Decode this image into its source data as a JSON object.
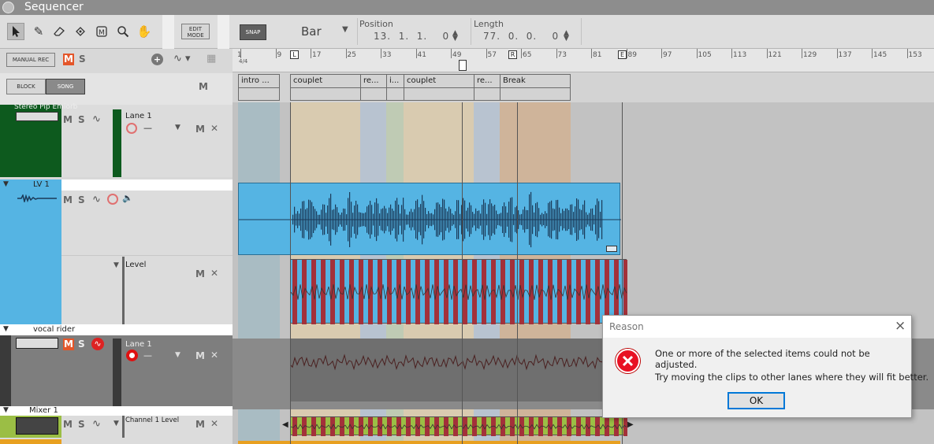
{
  "window": {
    "title": "Sequencer"
  },
  "toolbar": {
    "tools": [
      "select-arrow-icon",
      "pencil-icon",
      "eraser-icon",
      "razor-icon",
      "mute-tool-icon",
      "magnify-icon",
      "hand-icon"
    ],
    "edit_mode_label": "EDIT\nMODE",
    "snap_label": "SNAP",
    "snap_value": "Bar",
    "position_label": "Position",
    "position_value": "13.  1.  1.    0",
    "length_label": "Length",
    "length_value": "77.  0.  0.    0"
  },
  "controls": {
    "manual_rec": "MANUAL REC",
    "m": "M",
    "s": "S",
    "block": "BLOCK",
    "song": "SONG"
  },
  "ruler": {
    "time_sig": "4/4",
    "bars": [
      "1",
      "9",
      "17",
      "25",
      "33",
      "41",
      "49",
      "57",
      "65",
      "73",
      "81",
      "89",
      "97",
      "105",
      "113",
      "121",
      "129",
      "137",
      "145",
      "153"
    ],
    "left_marker": "L",
    "right_marker": "R",
    "end_marker": "E"
  },
  "blocks": [
    {
      "label": "intro ...",
      "color": "#7fb0c2"
    },
    {
      "label": "couplet",
      "color": "#f0d9a8"
    },
    {
      "label": "re...",
      "color": "#a7c3e2"
    },
    {
      "label": "i...",
      "color": "#c4dcae"
    },
    {
      "label": "couplet",
      "color": "#f0d9a8"
    },
    {
      "label": "re...",
      "color": "#a7c3e2"
    },
    {
      "label": "Break",
      "color": "#cd8035"
    }
  ],
  "tracks": {
    "stereo_name": "Stereo Pip Emiorb",
    "lane1_label": "Lane 1",
    "lane_dash": "—",
    "lv1_name": "LV 1",
    "level_label": "Level",
    "vocal_rider_name": "vocal rider",
    "mixer_name": "Mixer 1",
    "channel_level_label": "Channel 1 Level"
  },
  "dialog": {
    "title": "Reason",
    "message1": "One or more of the selected items could not be adjusted.",
    "message2": "Try moving the clips to other lanes where they will fit better.",
    "ok": "OK",
    "close_glyph": "×"
  }
}
